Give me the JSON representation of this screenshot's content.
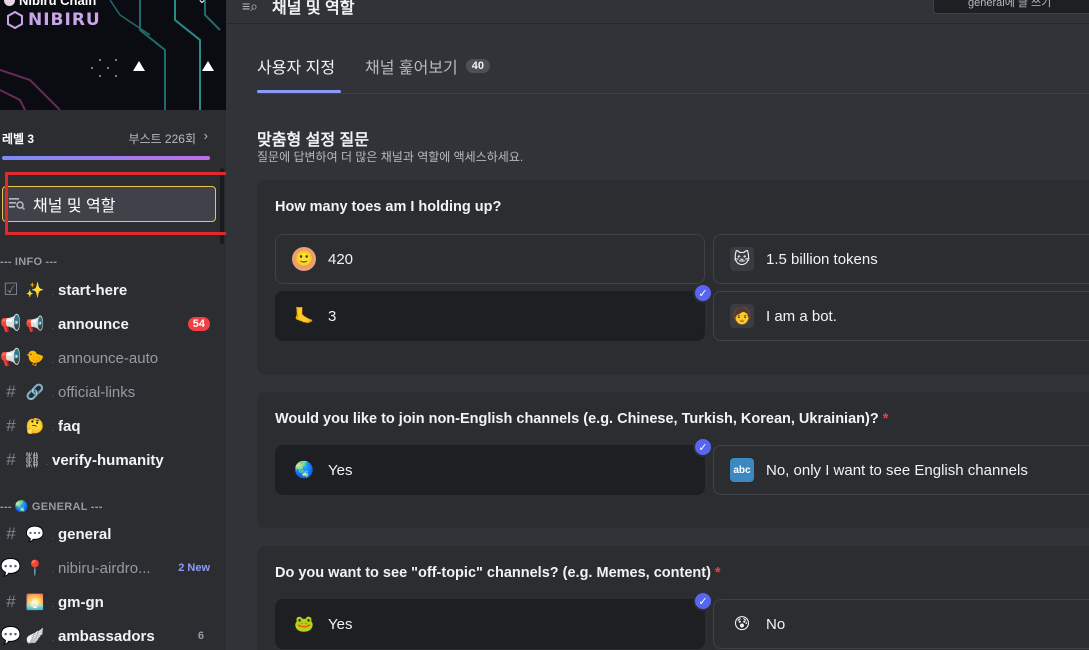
{
  "server": {
    "name": "Nibiru Chain",
    "brand": "NIBIRU",
    "level": "레벨 3",
    "boost": "부스트 226회"
  },
  "channels_roles_label": "채널 및 역할",
  "categories": [
    {
      "label": "INFO",
      "icon": ""
    },
    {
      "label": "GENERAL",
      "icon": "🌏"
    }
  ],
  "channels": [
    {
      "prefix": "☑",
      "emoji": "✨",
      "name": "start-here",
      "badge": "",
      "badge_type": "",
      "muted": false
    },
    {
      "prefix": "📢",
      "emoji": "📢",
      "name": "announce",
      "badge": "54",
      "badge_type": "red",
      "muted": false
    },
    {
      "prefix": "📢",
      "emoji": "🐤",
      "name": "announce-auto",
      "badge": "",
      "badge_type": "",
      "muted": true
    },
    {
      "prefix": "#",
      "emoji": "🔗",
      "name": "official-links",
      "badge": "",
      "badge_type": "",
      "muted": true
    },
    {
      "prefix": "#",
      "emoji": "🤔",
      "name": "faq",
      "badge": "",
      "badge_type": "",
      "muted": false
    },
    {
      "prefix": "#",
      "emoji": "⛓",
      "name": "verify-humanity",
      "badge": "",
      "badge_type": "",
      "muted": false
    },
    {
      "prefix": "#",
      "emoji": "💬",
      "name": "general",
      "badge": "",
      "badge_type": "",
      "muted": false
    },
    {
      "prefix": "💬",
      "emoji": "📍",
      "name": "nibiru-airdro...",
      "badge": "2 New",
      "badge_type": "new",
      "muted": true
    },
    {
      "prefix": "#",
      "emoji": "🌅",
      "name": "gm-gn",
      "badge": "",
      "badge_type": "",
      "muted": false
    },
    {
      "prefix": "💬",
      "emoji": "🪽",
      "name": "ambassadors",
      "badge": "6",
      "badge_type": "num",
      "muted": false
    }
  ],
  "header": {
    "title": "채널 및 역할",
    "search_text": "general에 글 쓰기"
  },
  "tabs": [
    {
      "label": "사용자 지정",
      "count": ""
    },
    {
      "label": "채널 훑어보기",
      "count": "40"
    }
  ],
  "section": {
    "title": "맞춤형 설정 질문",
    "subtitle": "질문에 답변하여 더 많은 채널과 역할에 액세스하세요."
  },
  "questions": [
    {
      "text": "How many toes am I holding up?",
      "required": false,
      "options": [
        {
          "label": "420",
          "icon": "🙂",
          "selected": false
        },
        {
          "label": "1.5 billion tokens",
          "icon": "🐱",
          "selected": false
        },
        {
          "label": "3",
          "icon": "🦶",
          "selected": true
        },
        {
          "label": "I am a bot.",
          "icon": "🧑",
          "selected": false
        }
      ]
    },
    {
      "text": "Would you like to join non-English channels (e.g. Chinese, Turkish, Korean, Ukrainian)?",
      "required": true,
      "options": [
        {
          "label": "Yes",
          "icon": "🌏",
          "selected": true
        },
        {
          "label": "No, only I want to see English channels",
          "icon": "🔤",
          "selected": false
        }
      ]
    },
    {
      "text": "Do you want to see \"off-topic\" channels? (e.g. Memes, content)",
      "required": true,
      "options": [
        {
          "label": "Yes",
          "icon": "🐸",
          "selected": true
        },
        {
          "label": "No",
          "icon": "😰",
          "selected": false
        }
      ]
    }
  ],
  "colors": {
    "accent": "#5865f2",
    "highlight_border": "#e0292c",
    "badge_red": "#f23f42",
    "new_badge": "#8b9bf7"
  }
}
